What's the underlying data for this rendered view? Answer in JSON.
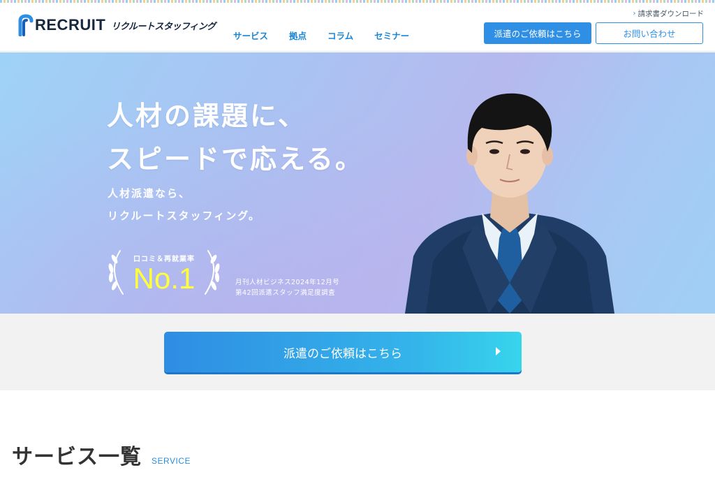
{
  "brand": {
    "wordmark": "RECRUIT",
    "subname": "リクルートスタッフィング"
  },
  "header": {
    "nav": [
      "サービス",
      "拠点",
      "コラム",
      "セミナー"
    ],
    "util_link": "請求書ダウンロード",
    "request_button": "派遣のご依頼はこちら",
    "contact_button": "お問い合わせ"
  },
  "hero": {
    "title_line1": "人材の課題に、",
    "title_line2": "スピードで応える。",
    "sub_line1": "人材派遣なら、",
    "sub_line2": "リクルートスタッフィング。",
    "award_label": "口コミ＆再就業率",
    "award_value": "No.1",
    "source_line1": "月刊人材ビジネス2024年12月号",
    "source_line2": "第42回派遣スタッフ満足度調査"
  },
  "cta": {
    "label": "派遣のご依頼はこちら"
  },
  "service": {
    "title": "サービス一覧",
    "title_en": "SERVICE"
  },
  "colors": {
    "accent": "#2f8fe4",
    "award_text": "#ffff3a",
    "logo_navy": "#17273f"
  }
}
